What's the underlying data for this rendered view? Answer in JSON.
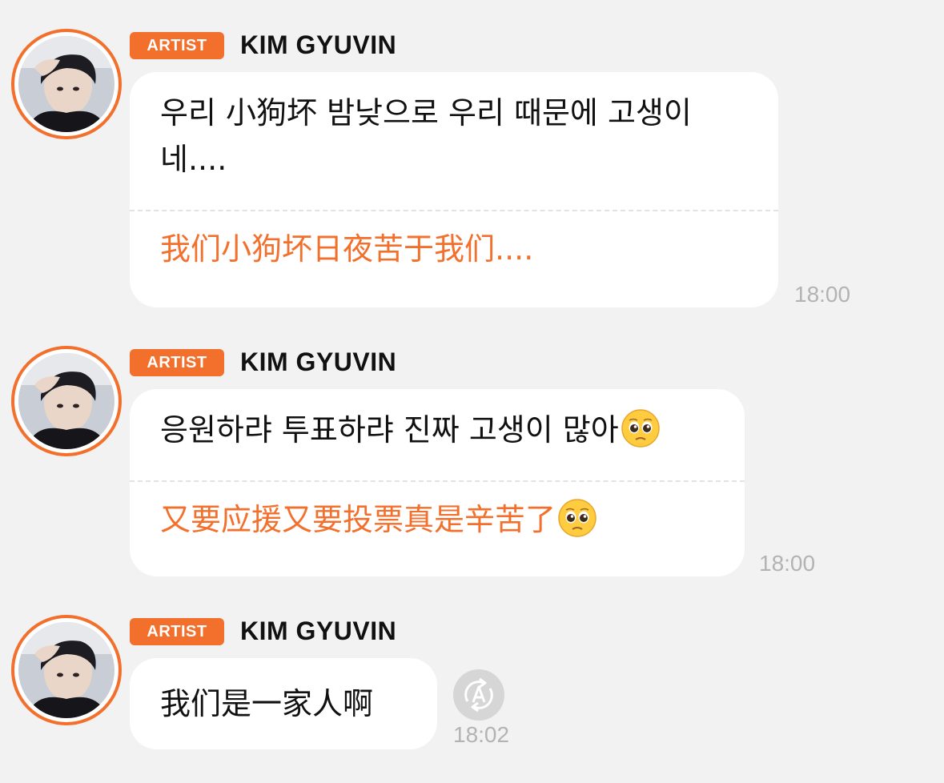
{
  "colors": {
    "accent": "#f36f2c",
    "background": "#f2f2f2",
    "bubble": "#ffffff",
    "timestamp": "#b3b3b3"
  },
  "messages": [
    {
      "badge": "ARTIST",
      "sender": "KIM GYUVIN",
      "text_ko": "우리 小狗坏 밤낮으로 우리 때문에 고생이 네....",
      "text_zh": "我们小狗坏日夜苦于我们....",
      "time": "18:00"
    },
    {
      "badge": "ARTIST",
      "sender": "KIM GYUVIN",
      "text_ko": "응원하랴 투표하랴 진짜 고생이 많아",
      "text_zh": "又要应援又要投票真是辛苦了",
      "emoji": "pleading-face-icon",
      "time": "18:00"
    },
    {
      "badge": "ARTIST",
      "sender": "KIM GYUVIN",
      "text": "我们是一家人啊",
      "translate_icon": "translate-icon",
      "time": "18:02"
    }
  ]
}
